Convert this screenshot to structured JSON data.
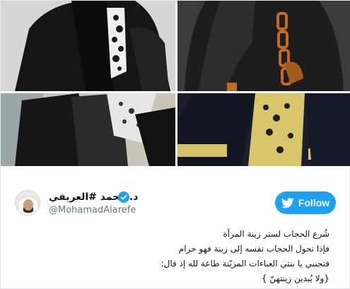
{
  "author": {
    "display_name": "د. محمد #العريفي",
    "handle": "@MohamadAlarefe",
    "verified": true
  },
  "follow_button": {
    "label": "Follow",
    "icon": "twitter-bird-icon",
    "color": "#1da1f2"
  },
  "tweet": {
    "lines": [
      "شُرع الحجاب لستر زينة المرأة",
      "فإذا تحول الحجاب نفسه إلى زينة فهو حرام",
      "فتجنبي يا بنتي العباءات المزيّنة طاعة لله إذ قال:",
      "{ولا يُبدين زينتهنّ }"
    ]
  },
  "media": [
    {
      "icon": "black-abaya-white-embroidery-photo"
    },
    {
      "icon": "black-abaya-gold-trim-photo"
    },
    {
      "icon": "black-abaya-lace-photo"
    },
    {
      "icon": "black-abaya-yellow-lace-photo"
    }
  ]
}
